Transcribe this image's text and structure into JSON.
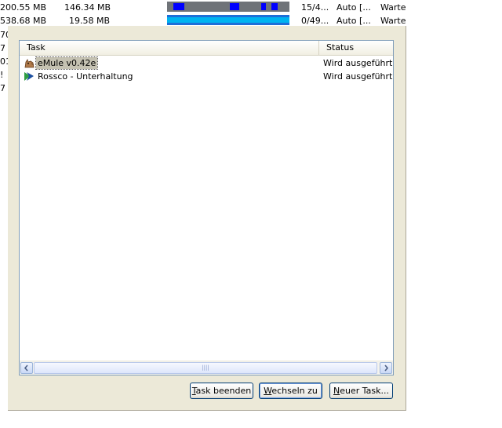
{
  "background_list": {
    "rows": [
      {
        "size": "200.55 MB",
        "done": "146.34 MB",
        "sources": "15/4...",
        "priority": "Auto [...",
        "status": "Warte"
      },
      {
        "size": "538.68 MB",
        "done": "19.58 MB",
        "sources": "0/49...",
        "priority": "Auto [...",
        "status": "Warte"
      }
    ],
    "left_edge_chars": [
      "70",
      "7",
      "01",
      "!",
      "7"
    ]
  },
  "task_manager": {
    "columns": {
      "task": "Task",
      "status": "Status"
    },
    "tasks": [
      {
        "name": "eMule v0.42e",
        "status": "Wird ausgeführt",
        "icon": "emule-icon",
        "selected": true
      },
      {
        "name": "Rossco - Unterhaltung",
        "status": "Wird ausgeführt",
        "icon": "messenger-chat-icon",
        "selected": false
      }
    ],
    "buttons": {
      "end_task": {
        "mnemonic": "T",
        "rest": "ask beenden"
      },
      "switch_to": {
        "mnemonic": "W",
        "rest": "echseln zu"
      },
      "new_task": {
        "mnemonic": "N",
        "rest": "euer Task..."
      }
    }
  },
  "colors": {
    "dialog_bg": "#ece9d8",
    "list_border": "#7f9db9",
    "progress_bg": "#6f7378",
    "progress_blue": "#0000ff",
    "progress_cyan": "#00b4f0"
  }
}
